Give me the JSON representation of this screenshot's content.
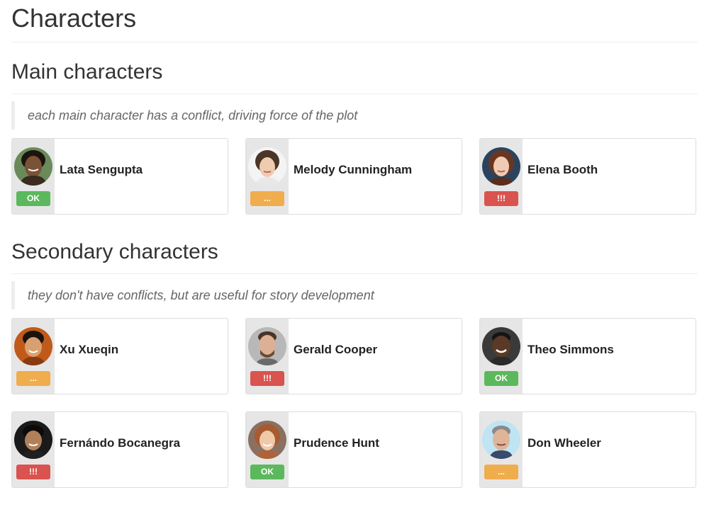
{
  "page_title": "Characters",
  "main_section": {
    "heading": "Main characters",
    "quote": "each main character has a conflict, driving force of the plot",
    "characters": [
      {
        "name": "Lata Sengupta",
        "status": "OK",
        "status_type": "ok"
      },
      {
        "name": "Melody Cunningham",
        "status": "...",
        "status_type": "pending"
      },
      {
        "name": "Elena Booth",
        "status": "!!!",
        "status_type": "alert"
      }
    ]
  },
  "secondary_section": {
    "heading": "Secondary characters",
    "quote": "they don't have conflicts, but are useful for story development",
    "characters": [
      {
        "name": "Xu Xueqin",
        "status": "...",
        "status_type": "pending"
      },
      {
        "name": "Gerald Cooper",
        "status": "!!!",
        "status_type": "alert"
      },
      {
        "name": "Theo Simmons",
        "status": "OK",
        "status_type": "ok"
      },
      {
        "name": "Fernándo Bocanegra",
        "status": "!!!",
        "status_type": "alert"
      },
      {
        "name": "Prudence Hunt",
        "status": "OK",
        "status_type": "ok"
      },
      {
        "name": "Don Wheeler",
        "status": "...",
        "status_type": "pending"
      }
    ]
  },
  "colors": {
    "ok": "#5cb85c",
    "pending": "#f0ad4e",
    "alert": "#d9534f"
  }
}
